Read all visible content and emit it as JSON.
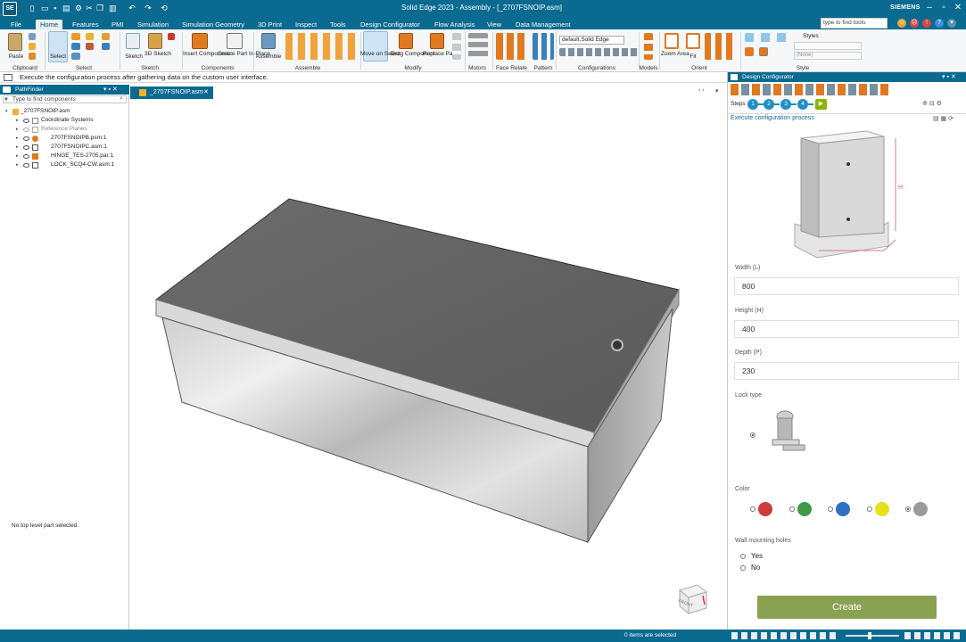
{
  "app": {
    "logo": "SE",
    "title": "Solid Edge 2023 - Assembly - [_2707FSNOIP.asm]",
    "brand": "SIEMENS",
    "search_placeholder": "type to find tools",
    "accent": "#0a6a90"
  },
  "menu": [
    "File",
    "Home",
    "Features",
    "PMI",
    "Simulation",
    "Simulation Geometry",
    "3D Print",
    "Inspect",
    "Tools",
    "Design Configurator",
    "Flow Analysis",
    "View",
    "Data Management"
  ],
  "ribbon": {
    "buttons": {
      "paste": "Paste",
      "select": "Select",
      "sketch": "Sketch",
      "sketch3d": "3D Sketch",
      "insert": "Insert Component",
      "create": "Create Part In-Place",
      "assemble": "Assemble",
      "move": "Move on Select",
      "drag": "Drag Component",
      "replace": "Replace Part",
      "zoom": "Zoom Area",
      "fit": "Fit",
      "styles": "Styles"
    },
    "groups": {
      "clipboard": "Clipboard",
      "select": "Select",
      "sketch": "Sketch",
      "components": "Components",
      "assemble": "Assemble",
      "modify": "Modify",
      "motors": "Motors",
      "face_relate": "Face Relate",
      "pattern": "Pattern",
      "configurations": "Configurations",
      "models": "Models",
      "orient": "Orient",
      "style": "Style"
    },
    "config_value": "default,Solid Edge",
    "style_value": "(None)"
  },
  "status_message": "Execute the configuration process after gathering data on the custom user interface.",
  "pathfinder": {
    "title": "PathFinder",
    "search_placeholder": "Type to find components",
    "root": "_2707FSNOIP.asm",
    "items": [
      {
        "label": "Coordinate Systems",
        "dim": false
      },
      {
        "label": "Reference Planes",
        "dim": true
      },
      {
        "label": "2707FSNOIPB.psm:1",
        "dim": false
      },
      {
        "label": "2707FSNOIPC.asm:1",
        "dim": false
      },
      {
        "label": "HINGE_TES-2705.par:1",
        "dim": false
      },
      {
        "label": "LOCK_SCQ4-CW.asm:1",
        "dim": false
      }
    ],
    "empty_message": "No top level part selected."
  },
  "doc_tab": "_2707FSNOIP.asm",
  "viewcube_label": "FRONT",
  "configurator": {
    "title": "Design Configurator",
    "steps_label": "Steps",
    "steps": [
      "1",
      "2",
      "3",
      "4"
    ],
    "process_title": "Execute configuration process",
    "dim_label": "H",
    "width_label": "Width (L)",
    "width_value": "800",
    "height_label": "Height (H)",
    "height_value": "400",
    "depth_label": "Depth (P)",
    "depth_value": "230",
    "lock_label": "Lock type",
    "color_label": "Color",
    "colors": [
      "#d03a3a",
      "#3f9a47",
      "#2f6fc4",
      "#e8e01c",
      "#9a9a9a"
    ],
    "selected_color_index": 4,
    "wall_label": "Wall mounting holes",
    "wall_yes": "Yes",
    "wall_no": "No",
    "create_label": "Create",
    "create_color": "#8aa154"
  },
  "statusbar": {
    "items_selected": "0 items are selected"
  }
}
